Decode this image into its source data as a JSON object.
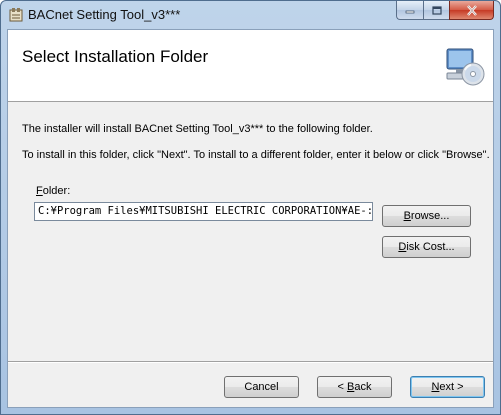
{
  "window": {
    "title": "BACnet Setting Tool_v3***",
    "controls": {
      "minimize": "minimize",
      "maximize": "maximize",
      "close": "close"
    }
  },
  "banner": {
    "title": "Select Installation Folder",
    "icon": "computer-disc-icon"
  },
  "body": {
    "line1": "The installer will install BACnet Setting Tool_v3*** to the following folder.",
    "line2": "To install in this folder, click \"Next\". To install to a different folder, enter it below or click \"Browse\"."
  },
  "folder": {
    "label_mnemonic": "F",
    "label_rest": "older:",
    "value": "C:¥Program Files¥MITSUBISHI ELECTRIC CORPORATION¥AE-:"
  },
  "buttons": {
    "browse": {
      "mnemonic": "B",
      "rest": "rowse..."
    },
    "disk_cost": {
      "mnemonic": "D",
      "rest": "isk Cost..."
    },
    "cancel": "Cancel",
    "back": {
      "prefix": "< ",
      "mnemonic": "B",
      "rest": "ack"
    },
    "next": {
      "mnemonic": "N",
      "rest": "ext >"
    }
  },
  "colors": {
    "title_bar": "#bfd4ea",
    "close_button": "#c63a24",
    "client_bg": "#f0f0f0",
    "default_button_border": "#3c7fb1"
  }
}
